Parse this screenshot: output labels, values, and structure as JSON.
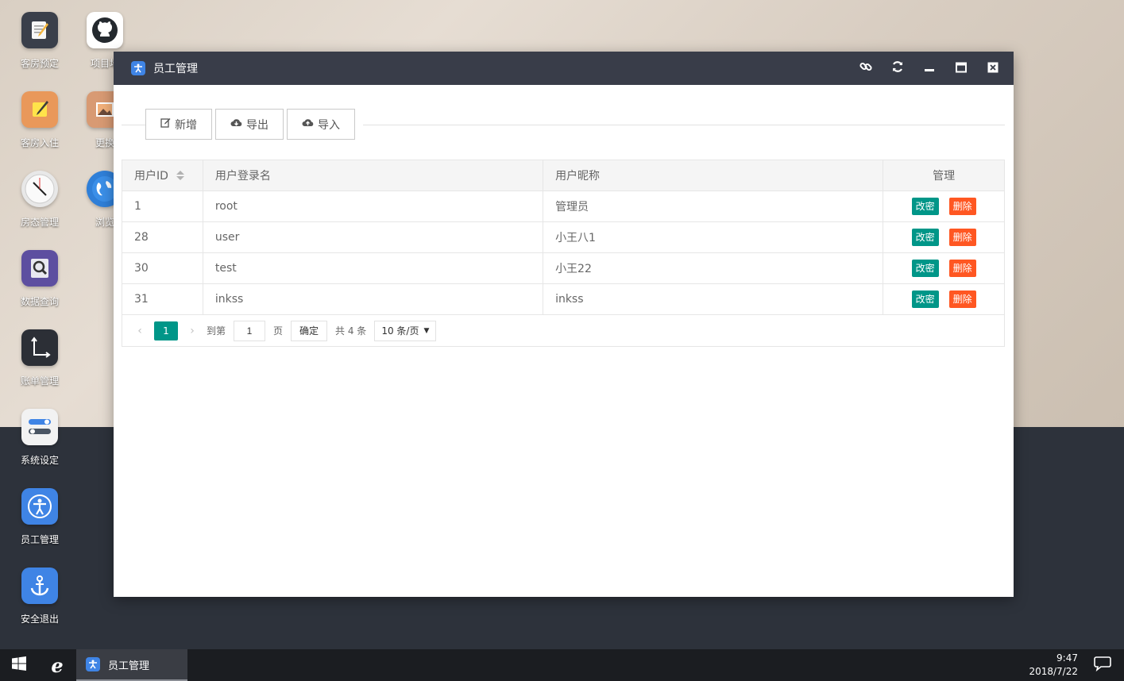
{
  "desktop": {
    "icons": [
      {
        "label": "客房预定",
        "icon": "notepad-icon"
      },
      {
        "label": "项目地",
        "icon": "github-icon"
      },
      {
        "label": "客房入住",
        "icon": "notes-pen-icon"
      },
      {
        "label": "更换",
        "icon": "picture-icon"
      },
      {
        "label": "房态管理",
        "icon": "clock-icon"
      },
      {
        "label": "浏览",
        "icon": "globe-icon"
      },
      {
        "label": "数据查询",
        "icon": "magnifier-document-icon"
      },
      {
        "label": "账单管理",
        "icon": "axes-icon"
      },
      {
        "label": "系统设定",
        "icon": "toggle-settings-icon"
      },
      {
        "label": "员工管理",
        "icon": "accessibility-person-icon"
      },
      {
        "label": "安全退出",
        "icon": "anchor-icon"
      }
    ]
  },
  "window": {
    "title": "员工管理",
    "toolbar": {
      "add_label": "新增",
      "export_label": "导出",
      "import_label": "导入"
    },
    "table": {
      "columns": [
        "用户ID",
        "用户登录名",
        "用户昵称",
        "管理"
      ],
      "rows": [
        {
          "id": "1",
          "login": "root",
          "nickname": "管理员"
        },
        {
          "id": "28",
          "login": "user",
          "nickname": "小王八1"
        },
        {
          "id": "30",
          "login": "test",
          "nickname": "小王22"
        },
        {
          "id": "31",
          "login": "inkss",
          "nickname": "inkss"
        }
      ],
      "edit_label": "改密",
      "delete_label": "删除"
    },
    "pager": {
      "current_page": "1",
      "goto_label": "到第",
      "goto_value": "1",
      "page_suffix": "页",
      "confirm_label": "确定",
      "total_text": "共 4 条",
      "page_size": "10 条/页"
    }
  },
  "taskbar": {
    "task_label": "员工管理",
    "time": "9:47",
    "date": "2018/7/22"
  },
  "colors": {
    "primary": "#009688",
    "danger": "#ff5722",
    "title_bar": "#393d49"
  }
}
